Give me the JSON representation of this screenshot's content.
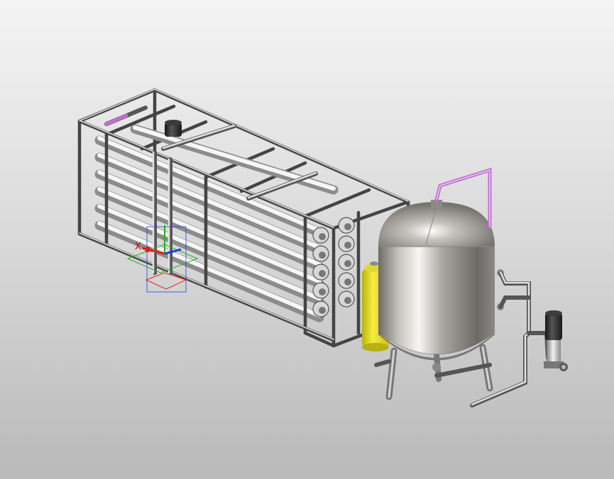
{
  "viewport": {
    "background_top": "#f4f4f4",
    "background_bottom": "#b9b9b9"
  },
  "triad": {
    "x_label": "X",
    "x_color": "#e02020",
    "y_color": "#20b020",
    "z_color": "#2040e0"
  },
  "colors": {
    "frame_steel": "#8a8a8a",
    "membrane_tube": "#d9d9d9",
    "tank_steel": "#a8a49f",
    "dosing_tank": "#e8e020",
    "purple_pipe": "#c070d0",
    "pump_motor": "#2a2a2a"
  },
  "components": [
    {
      "name": "membrane-rack",
      "icon": "steel-frame-icon"
    },
    {
      "name": "pressure-tank",
      "icon": "vessel-icon"
    },
    {
      "name": "dosing-tank",
      "icon": "tank-icon"
    },
    {
      "name": "booster-pump",
      "icon": "pump-icon"
    }
  ]
}
